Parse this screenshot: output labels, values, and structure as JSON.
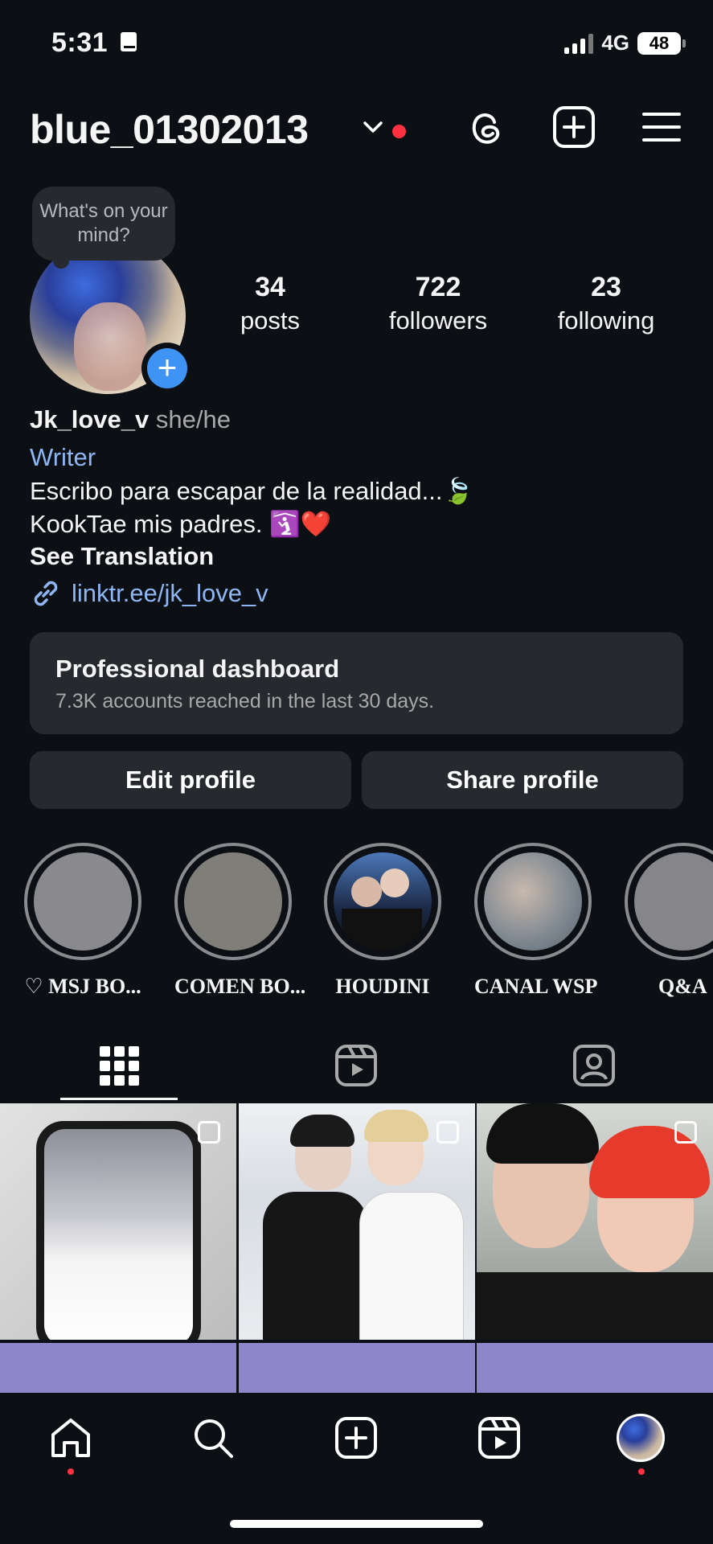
{
  "status_bar": {
    "time": "5:31",
    "network": "4G",
    "battery": "48"
  },
  "header": {
    "username": "blue_01302013",
    "icons": [
      "threads-icon",
      "create-post-icon",
      "menu-icon"
    ]
  },
  "note_bubble": {
    "text": "What's on your mind?"
  },
  "stats": [
    {
      "value": "34",
      "label": "posts"
    },
    {
      "value": "722",
      "label": "followers"
    },
    {
      "value": "23",
      "label": "following"
    }
  ],
  "bio": {
    "name": "Jk_love_v",
    "pronouns": "she/he",
    "category": "Writer",
    "line1": "Escribo para escapar de la realidad...🍃",
    "line2": "KookTae mis padres. 🛐❤️",
    "see_translation": "See Translation",
    "link": "linktr.ee/jk_love_v"
  },
  "dashboard": {
    "title": "Professional dashboard",
    "subtitle": "7.3K accounts reached in the last 30 days."
  },
  "buttons": {
    "edit": "Edit profile",
    "share": "Share profile"
  },
  "highlights": [
    {
      "label": "♡ MSJ BO..."
    },
    {
      "label": "COMEN BO..."
    },
    {
      "label": "HOUDINI"
    },
    {
      "label": "CANAL WSP"
    },
    {
      "label": "Q&A"
    }
  ],
  "colors": {
    "background": "#0c1014",
    "surface": "#262a2f",
    "accent_blue": "#3f93f5",
    "link_blue": "#8fb6f4",
    "notification_red": "#ff3040"
  }
}
